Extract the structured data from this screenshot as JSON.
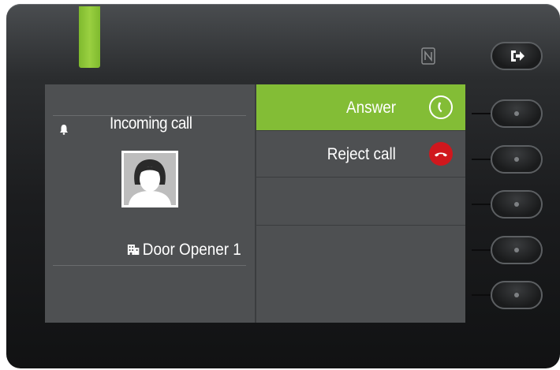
{
  "call": {
    "status_label": "Incoming call",
    "contact_name": "Door Opener 1"
  },
  "menu": {
    "items": [
      {
        "label": "Answer",
        "icon": "answer-call-icon",
        "state": "selected"
      },
      {
        "label": "Reject call",
        "icon": "reject-call-icon",
        "state": "normal"
      },
      {
        "label": "",
        "icon": "",
        "state": "empty"
      },
      {
        "label": "",
        "icon": "",
        "state": "empty"
      }
    ]
  },
  "colors": {
    "accent_green": "#83bd36",
    "reject_red": "#d0171d",
    "screen_bg": "#4e5052"
  },
  "icons": {
    "status_icon": "bell-icon",
    "contact_type_icon": "building-icon",
    "exit_key_icon": "exit-arrow-icon",
    "nfc_icon": "nfc-icon"
  }
}
